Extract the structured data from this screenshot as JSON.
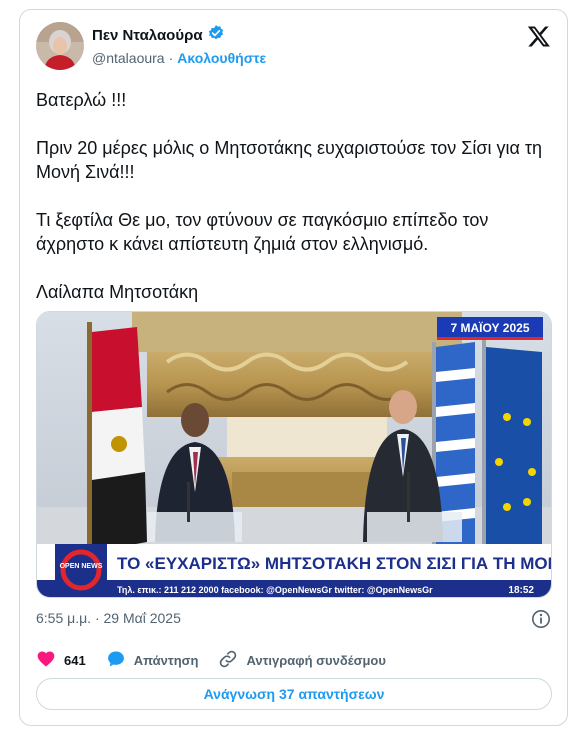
{
  "author": {
    "display_name": "Πεν Νταλαούρα",
    "handle": "@ntalaoura",
    "separator": "·",
    "follow_label": "Ακολουθήστε",
    "verified": true
  },
  "tweet": {
    "paragraphs": [
      "Βατερλώ !!!",
      "Πριν 20 μέρες μόλις ο Μητσοτάκης ευχαριστούσε τον Σίσι για τη Μονή Σινά!!!",
      "Τι ξεφτίλα Θε μο, τον φτύνουν σε παγκόσμιο επίπεδο τον άχρηστο κ κάνει απίστευτη ζημιά στον ελληνισμό.",
      "Λαίλαπα Μητσοτάκη"
    ],
    "timestamp": "6:55 μ.μ. · 29 Μαΐ 2025"
  },
  "media": {
    "date_badge": "7 ΜΑΪΟΥ 2025",
    "headline": "ΤΟ «ΕΥΧΑΡΙΣΤΩ» ΜΗΤΣΟΤΑΚΗ ΣΤΟΝ ΣΙΣΙ ΓΙΑ ΤΗ ΜΟΝΗ ΣΙΝΑ",
    "ticker": "Τηλ. επικ.: 211 212 2000 facebook: @OpenNewsGr twitter: @OpenNewsGr",
    "clock": "18:52",
    "channel_logo_text": "OPEN NEWS",
    "colors": {
      "ticker_blue": "#1c2f8a",
      "badge_blue": "#1a3bb5",
      "logo_red": "#e3262c"
    }
  },
  "actions": {
    "like_count": "641",
    "reply_label": "Απάντηση",
    "copy_link_label": "Αντιγραφή συνδέσμου"
  },
  "read_replies_label": "Ανάγνωση 37 απαντήσεων",
  "colors": {
    "accent": "#1d9bf0",
    "like": "#f91880",
    "muted": "#536471"
  }
}
